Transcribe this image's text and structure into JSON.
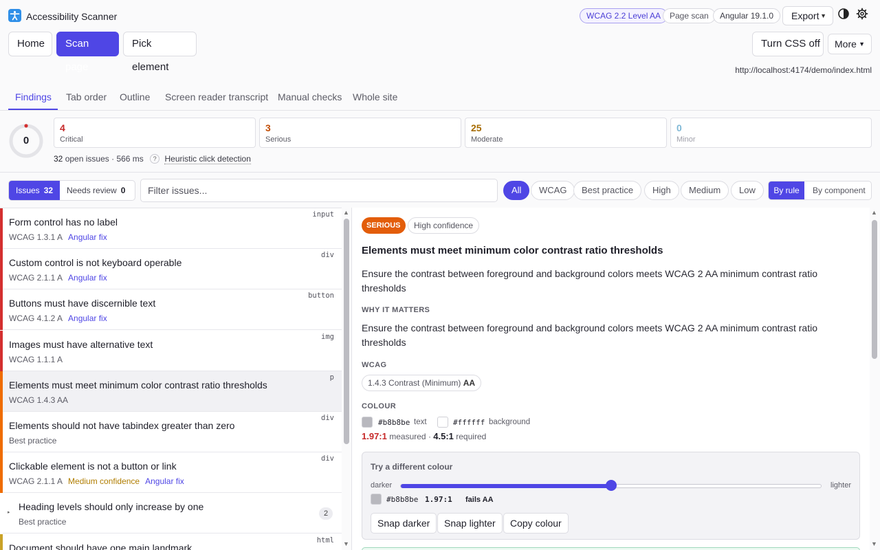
{
  "app": {
    "title": "Accessibility Scanner"
  },
  "header": {
    "badges": {
      "wcag": "WCAG 2.2 Level AA",
      "scope": "Page scan",
      "framework": "Angular 19.1.0"
    },
    "export_label": "Export"
  },
  "nav": {
    "home": "Home",
    "scan": "Scan page",
    "pick": "Pick element",
    "css_toggle": "Turn CSS off",
    "more": "More",
    "url": "http://localhost:4174/demo/index.html"
  },
  "tabs": [
    "Findings",
    "Tab order",
    "Outline",
    "Screen reader transcript",
    "Manual checks",
    "Whole site"
  ],
  "summary": {
    "score": "0",
    "critical": {
      "count": "4",
      "label": "Critical"
    },
    "serious": {
      "count": "3",
      "label": "Serious"
    },
    "moderate": {
      "count": "25",
      "label": "Moderate"
    },
    "minor": {
      "count": "0",
      "label": "Minor"
    },
    "open_count": "32",
    "open_label": "open issues",
    "duration": "566 ms",
    "help": "?",
    "heuristic": "Heuristic click detection"
  },
  "filters": {
    "issues_label": "Issues",
    "issues_count": "32",
    "review_label": "Needs review",
    "review_count": "0",
    "search_placeholder": "Filter issues...",
    "chips": {
      "all": "All",
      "wcag": "WCAG",
      "best": "Best practice",
      "high": "High",
      "medium": "Medium",
      "low": "Low"
    },
    "group_rule": "By rule",
    "group_component": "By component"
  },
  "issues": [
    {
      "title": "Form control has no label",
      "sub": "WCAG 1.3.1 A",
      "fix": "Angular fix",
      "tag": "input",
      "color": "#d32f2f"
    },
    {
      "title": "Custom control is not keyboard operable",
      "sub": "WCAG 2.1.1 A",
      "fix": "Angular fix",
      "tag": "div",
      "color": "#d32f2f"
    },
    {
      "title": "Buttons must have discernible text",
      "sub": "WCAG 4.1.2 A",
      "fix": "Angular fix",
      "tag": "button",
      "color": "#d32f2f"
    },
    {
      "title": "Images must have alternative text",
      "sub": "WCAG 1.1.1 A",
      "tag": "img",
      "color": "#d32f2f"
    },
    {
      "title": "Elements must meet minimum color contrast ratio thresholds",
      "sub": "WCAG 1.4.3 AA",
      "tag": "p",
      "color": "#ef6c00"
    },
    {
      "title": "Elements should not have tabindex greater than zero",
      "sub": "Best practice",
      "tag": "div",
      "color": "#ef6c00"
    },
    {
      "title": "Clickable element is not a button or link",
      "sub": "WCAG 2.1.1 A",
      "confidence": "Medium confidence",
      "fix": "Angular fix",
      "tag": "div",
      "color": "#ef6c00"
    },
    {
      "title": "Heading levels should only increase by one",
      "sub": "Best practice",
      "count": "2",
      "chevron": "▸",
      "color": "#ffffff"
    },
    {
      "title": "Document should have one main landmark",
      "sub": "",
      "tag": "html",
      "color": "#c9a227"
    }
  ],
  "detail": {
    "severity": "SERIOUS",
    "confidence": "High confidence",
    "title": "Elements must meet minimum color contrast ratio thresholds",
    "description": "Ensure the contrast between foreground and background colors meets WCAG 2 AA minimum contrast ratio thresholds",
    "why_heading": "WHY IT MATTERS",
    "why_text": "Ensure the contrast between foreground and background colors meets WCAG 2 AA minimum contrast ratio thresholds",
    "wcag_heading": "WCAG",
    "wcag_criterion": "1.4.3 Contrast (Minimum)",
    "wcag_level": "AA",
    "colour_heading": "COLOUR",
    "fg_hex": "#b8b8be",
    "fg_label": "text",
    "bg_hex": "#ffffff",
    "bg_label": "background",
    "measured": "1.97:1",
    "measured_label": "measured",
    "separator": "·",
    "required": "4.5:1",
    "required_label": "required",
    "try": {
      "title": "Try a different colour",
      "darker": "darker",
      "lighter": "lighter",
      "slider_value": 0.5,
      "hex": "#b8b8be",
      "ratio": "1.97:1",
      "result": "fails AA",
      "snap_darker": "Snap darker",
      "snap_lighter": "Snap lighter",
      "copy": "Copy colour"
    }
  },
  "colors": {
    "accent": "#4f46e5",
    "serious": "#e35d0a",
    "critical": "#c62828"
  }
}
